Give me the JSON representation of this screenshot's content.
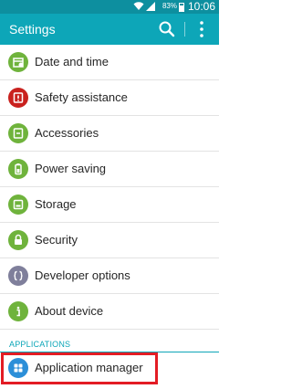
{
  "status_bar": {
    "battery_percent": "83%",
    "time": "10:06"
  },
  "app_bar": {
    "title": "Settings"
  },
  "settings": [
    {
      "label": "Date and time",
      "icon": "calendar-icon",
      "color": "#6fb33c"
    },
    {
      "label": "Safety assistance",
      "icon": "warning-icon",
      "color": "#c9211e"
    },
    {
      "label": "Accessories",
      "icon": "accessories-icon",
      "color": "#6fb33c"
    },
    {
      "label": "Power saving",
      "icon": "battery-icon",
      "color": "#6fb33c"
    },
    {
      "label": "Storage",
      "icon": "storage-icon",
      "color": "#6fb33c"
    },
    {
      "label": "Security",
      "icon": "lock-icon",
      "color": "#6fb33c"
    },
    {
      "label": "Developer options",
      "icon": "code-braces-icon",
      "color": "#7f7f9b"
    },
    {
      "label": "About device",
      "icon": "info-icon",
      "color": "#6fb33c"
    }
  ],
  "section_header": "APPLICATIONS",
  "applications": [
    {
      "label": "Application manager",
      "icon": "grid-icon",
      "color": "#2c8fd8"
    }
  ]
}
